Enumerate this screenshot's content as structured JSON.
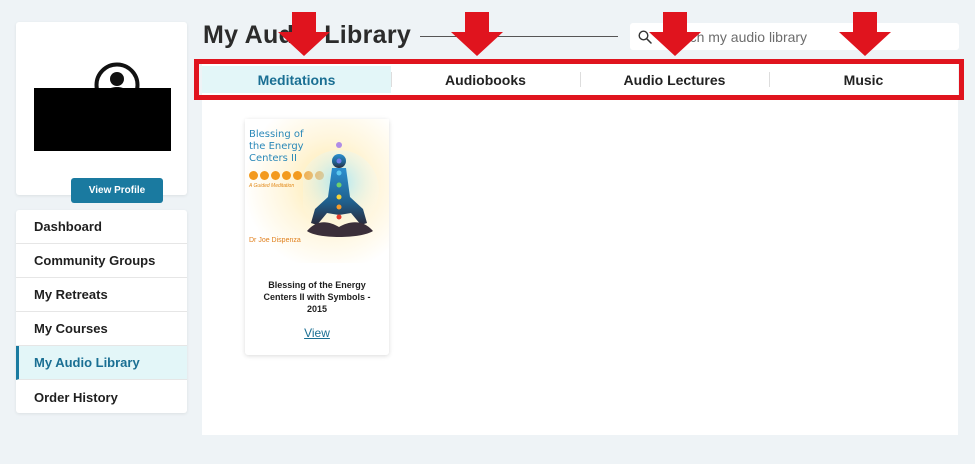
{
  "profile": {
    "view_profile_label": "View Profile"
  },
  "sidebar": {
    "items": [
      {
        "label": "Dashboard"
      },
      {
        "label": "Community Groups"
      },
      {
        "label": "My Retreats"
      },
      {
        "label": "My Courses"
      },
      {
        "label": "My Audio Library",
        "active": true
      },
      {
        "label": "Order History"
      }
    ]
  },
  "header": {
    "title": "My Audio Library"
  },
  "search": {
    "placeholder": "Search my audio library",
    "value": ""
  },
  "tabs": [
    {
      "label": "Meditations",
      "active": true
    },
    {
      "label": "Audiobooks"
    },
    {
      "label": "Audio Lectures"
    },
    {
      "label": "Music"
    }
  ],
  "library_items": [
    {
      "cover": {
        "title": "Blessing of the Energy Centers II",
        "subtitle": "A Guided Meditation",
        "author": "Dr Joe Dispenza"
      },
      "title": "Blessing of the Energy Centers II with Symbols - 2015",
      "link_label": "View"
    }
  ],
  "icons": {
    "avatar": "user-circle-icon",
    "search": "search-icon",
    "annotation": "red-down-arrow-icon"
  },
  "colors": {
    "accent": "#1a7aa0",
    "active_tab_bg": "#e3f6f8",
    "annotation_red": "#e0141e",
    "page_bg": "#eef3f6"
  }
}
